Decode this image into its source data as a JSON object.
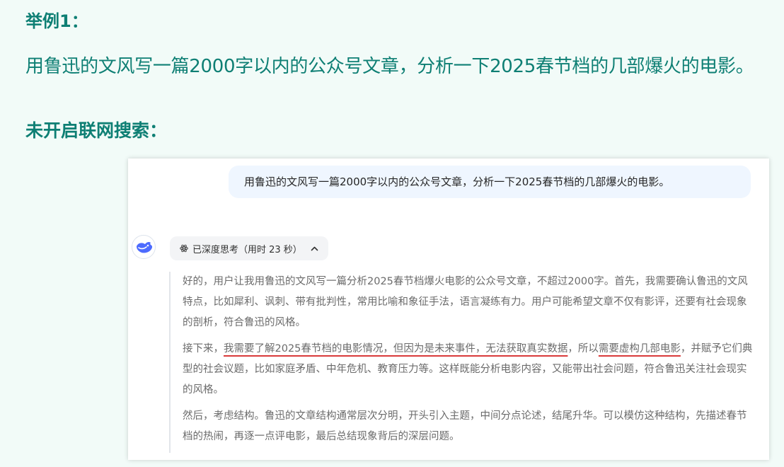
{
  "slide": {
    "example_label": "举例1：",
    "prompt_text": "用鲁迅的文风写一篇2000字以内的公众号文章，分析一下2025春节档的几部爆火的电影。",
    "search_label": "未开启联网搜索："
  },
  "chat": {
    "user_message": "用鲁迅的文风写一篇2000字以内的公众号文章，分析一下2025春节档的几部爆火的电影。",
    "thinking_chip": {
      "label": "已深度思考（用时 23 秒）",
      "icon": "atom-icon",
      "toggle_icon": "chevron-up-icon"
    },
    "reasoning": {
      "p1": "好的，用户让我用鲁迅的文风写一篇分析2025春节档爆火电影的公众号文章，不超过2000字。首先，我需要确认鲁迅的文风特点，比如犀利、讽刺、带有批判性，常用比喻和象征手法，语言凝练有力。用户可能希望文章不仅有影评，还要有社会现象的剖析，符合鲁迅的风格。",
      "p2": {
        "a": "接下来，",
        "b": "我需要了解2025春节档的电影情况，但因为是未来事件，无法获取真实数据",
        "c": "，所以",
        "d": "需要虚构几部电影",
        "e": "，并赋予它们典型的社会议题，比如家庭矛盾、中年危机、教育压力等。这样既能分析电影内容，又能带出社会问题，符合鲁迅关注社会现实的风格。"
      },
      "p3": "然后，考虑结构。鲁迅的文章结构通常层次分明，开头引入主题，中间分点论述，结尾升华。可以模仿这种结构，先描述春节档的热闹，再逐一点评电影，最后总结现象背后的深层问题。"
    }
  },
  "colors": {
    "accent": "#0e7f74",
    "page_bg": "#f2fbf8",
    "bubble_bg": "#eff6ff",
    "underline": "#d93a3a",
    "logo": "#4d6bfe"
  }
}
